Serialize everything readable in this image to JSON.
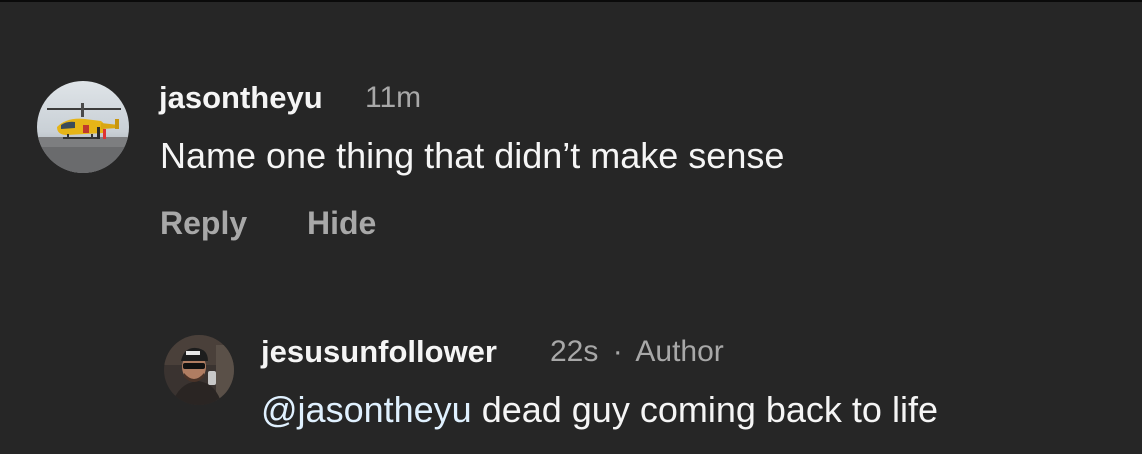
{
  "comment": {
    "username": "jasontheyu",
    "time": "11m",
    "text": "Name one thing that didn’t make sense",
    "actions": {
      "reply": "Reply",
      "hide": "Hide"
    },
    "avatar_icon": "helicopter-photo"
  },
  "reply": {
    "username": "jesusunfollower",
    "time": "22s",
    "separator": "·",
    "role": "Author",
    "mention": "@jasontheyu",
    "text": " dead guy coming back to life",
    "avatar_icon": "person-selfie-photo"
  },
  "colors": {
    "background": "#262626",
    "primary_text": "#f5f5f5",
    "secondary_text": "#a8a8a8",
    "mention": "#e0f1ff"
  }
}
